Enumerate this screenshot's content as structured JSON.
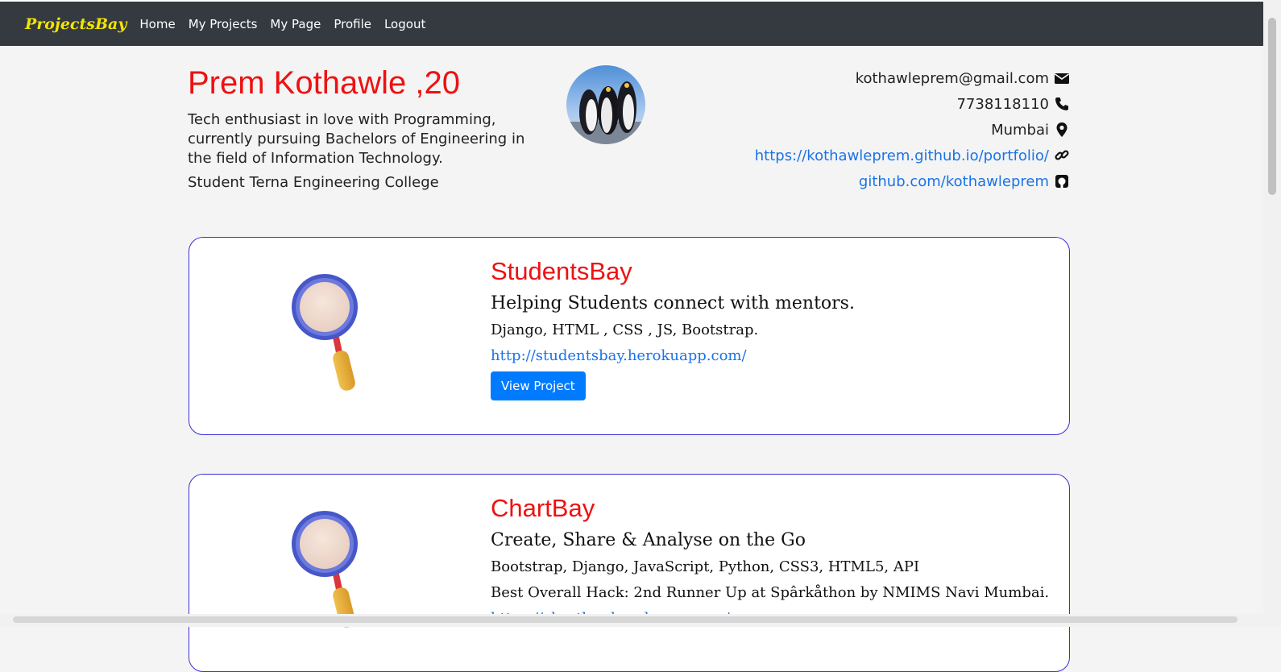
{
  "navbar": {
    "brand": "ProjectsBay",
    "links": [
      "Home",
      "My Projects",
      "My Page",
      "Profile",
      "Logout"
    ]
  },
  "profile": {
    "name": "Prem Kothawle ,20",
    "bio": "Tech enthusiast in love with Programming, currently pursuing Bachelors of Engineering in the field of Information Technology.",
    "occupation": "Student Terna Engineering College",
    "contacts": {
      "email": "kothawleprem@gmail.com",
      "phone": "7738118110",
      "location": "Mumbai",
      "portfolio": "https://kothawleprem.github.io/portfolio/",
      "github": "github.com/kothawleprem"
    }
  },
  "projects": [
    {
      "title": "StudentsBay",
      "description": "Helping Students connect with mentors.",
      "tech": "Django, HTML , CSS , JS, Bootstrap.",
      "link": "http://studentsbay.herokuapp.com/",
      "button": "View Project"
    },
    {
      "title": "ChartBay",
      "description": "Create, Share & Analyse on the Go",
      "tech": "Bootstrap, Django, JavaScript, Python, CSS3, HTML5, API",
      "award": "Best Overall Hack: 2nd Runner Up at Spârkåthon by NMIMS Navi Mumbai.",
      "link": "https://chartbay.herokuapp.com/"
    }
  ],
  "colors": {
    "navbar_bg": "#343a40",
    "brand": "#f2e600",
    "accent_red": "#ee1111",
    "link_blue": "#1a73e8",
    "button_blue": "#007bff",
    "card_border": "#3b2fd6"
  },
  "icons": [
    "envelope-icon",
    "phone-icon",
    "map-marker-icon",
    "link-icon",
    "github-icon",
    "magnifier-icon",
    "penguins-avatar"
  ]
}
